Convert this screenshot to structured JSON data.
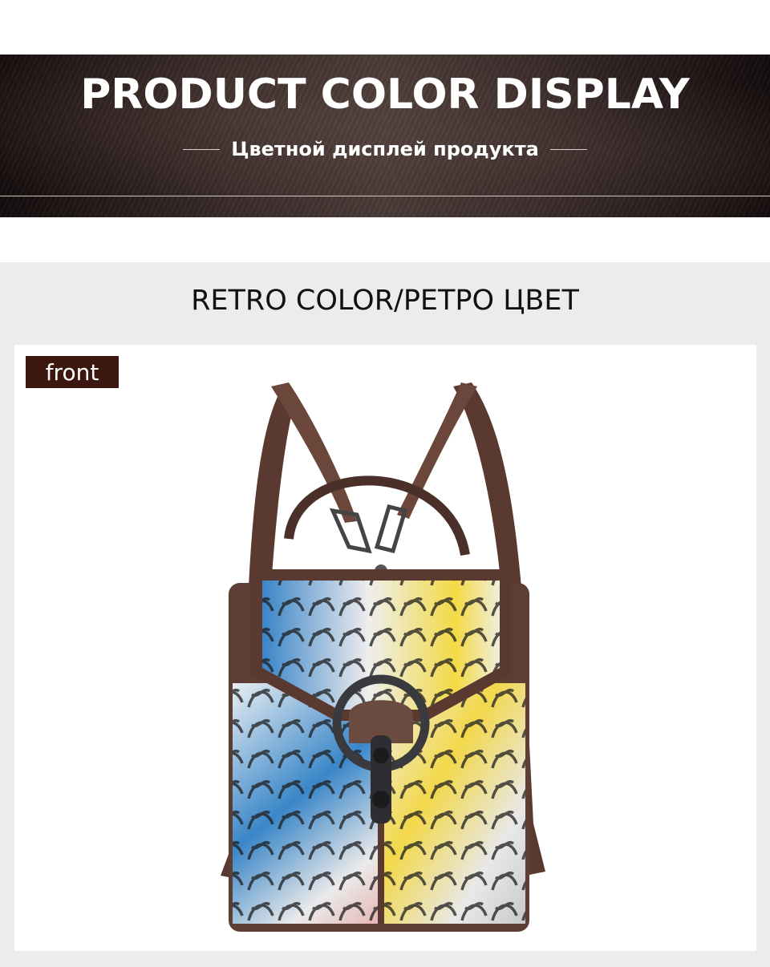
{
  "banner": {
    "title": "PRODUCT COLOR DISPLAY",
    "subtitle": "Цветной дисплей продукта"
  },
  "section": {
    "title": "RETRO COLOR/РЕТРО ЦВЕТ"
  },
  "photo": {
    "tag_label": "front",
    "tag_color": "#3b1710"
  }
}
